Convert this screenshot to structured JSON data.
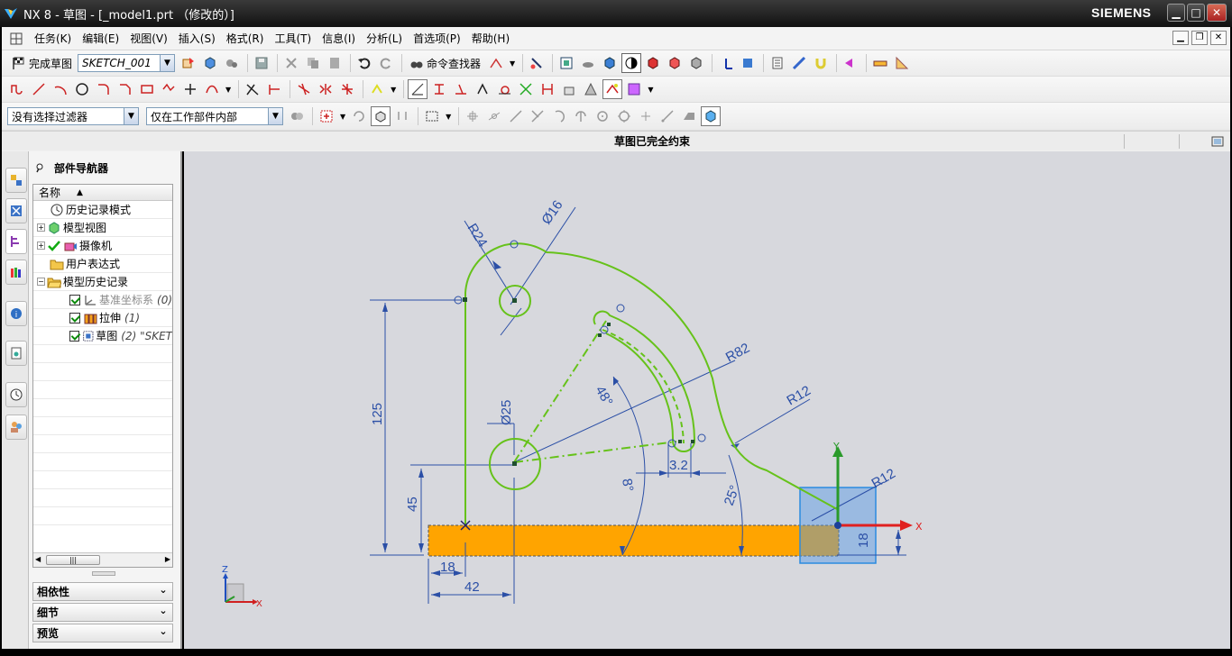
{
  "window": {
    "title": "NX 8 - 草图 - [_model1.prt （修改的）]",
    "brand": "SIEMENS"
  },
  "menu": {
    "items": [
      "任务(K)",
      "编辑(E)",
      "视图(V)",
      "插入(S)",
      "格式(R)",
      "工具(T)",
      "信息(I)",
      "分析(L)",
      "首选项(P)",
      "帮助(H)"
    ]
  },
  "toolbar": {
    "finish_sketch": "完成草图",
    "sketch_name": "SKETCH_001",
    "command_finder": "命令查找器"
  },
  "selection_bar": {
    "filter": "没有选择过滤器",
    "scope": "仅在工作部件内部"
  },
  "status": {
    "message": "草图已完全约束"
  },
  "navigator": {
    "title": "部件导航器",
    "column": "名称",
    "rows": [
      {
        "label": "历史记录模式",
        "suffix": ""
      },
      {
        "label": "模型视图",
        "suffix": ""
      },
      {
        "label": "摄像机",
        "suffix": ""
      },
      {
        "label": "用户表达式",
        "suffix": ""
      },
      {
        "label": "模型历史记录",
        "suffix": ""
      },
      {
        "label": "基准坐标系",
        "suffix": "(0)"
      },
      {
        "label": "拉伸",
        "suffix": "(1)"
      },
      {
        "label": "草图",
        "suffix": "(2) \"SKET"
      }
    ],
    "sections": [
      "相依性",
      "细节",
      "预览"
    ]
  },
  "sketch": {
    "dimensions": {
      "r24": "R24",
      "d16": "Ø16",
      "r82": "R82",
      "r12a": "R12",
      "r12b": "R12",
      "d25": "Ø25",
      "a48": "48°",
      "a8": "8°",
      "a25": "25°",
      "w32": "3.2",
      "h125": "125",
      "h45": "45",
      "h18r": "18",
      "w18": "18",
      "w42": "42"
    },
    "axes": {
      "x": "X",
      "y": "Y",
      "z": "Z"
    },
    "colors": {
      "profile": "#66c21a",
      "dimension": "#2b4fa6",
      "extrude_fill": "#ffa400",
      "datum_box": "#3f9be8"
    }
  }
}
